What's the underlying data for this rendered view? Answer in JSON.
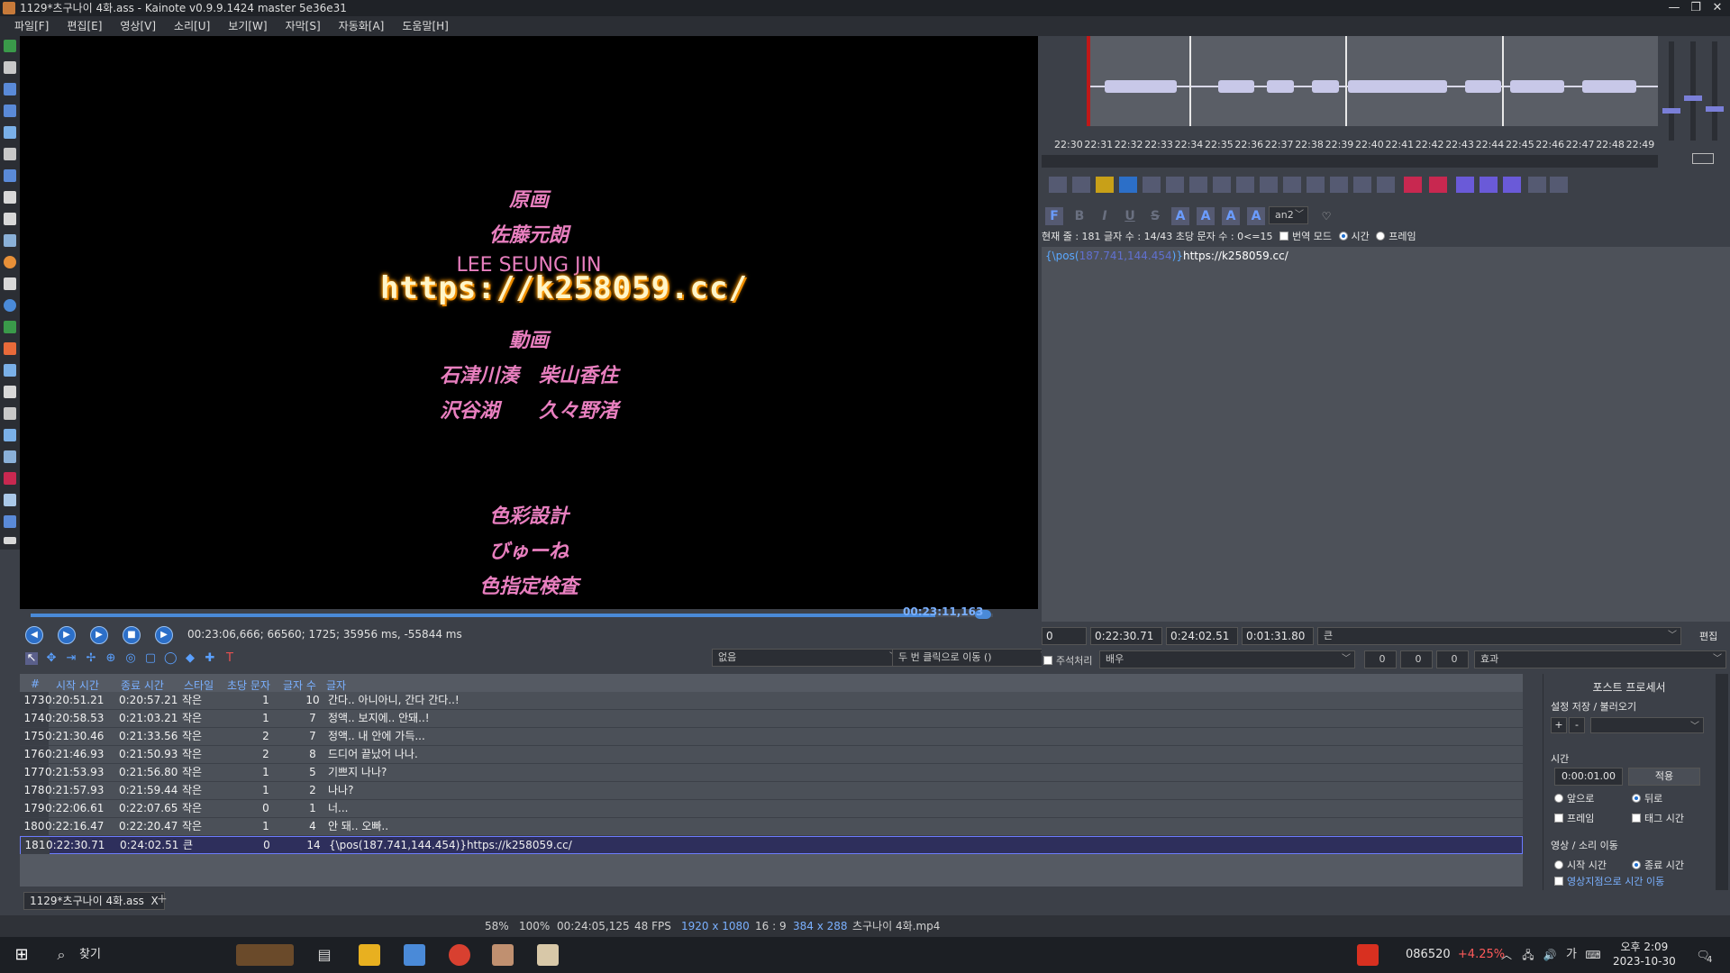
{
  "window": {
    "title": "1129*츠구나이 4화.ass - Kainote v0.9.9.1424  master 5e36e31",
    "minimize": "—",
    "maximize": "❐",
    "close": "✕"
  },
  "menu": [
    "파일[F]",
    "편집[E]",
    "영상[V]",
    "소리[U]",
    "보기[W]",
    "자막[S]",
    "자동화[A]",
    "도움말[H]"
  ],
  "video": {
    "lines": [
      "原画",
      "佐藤元朗",
      "LEE SEUNG JIN",
      "動画",
      "石津川湊　柴山香住",
      "沢谷湖　　久々野渚",
      "色彩設計",
      "びゅーね",
      "色指定検査"
    ],
    "overlay_url": "https://k258059.cc/",
    "seek_time": "00:23:11,163",
    "seek_progress": 0.94,
    "info": "00:23:06,666;  66560;  1725;  35956 ms, -55844 ms"
  },
  "video_toolbar": {
    "combo1": "없음",
    "combo2": "두 번 클릭으로 이동 ()"
  },
  "grid": {
    "headers": [
      "#",
      "시작 시간",
      "종료 시간",
      "스타일",
      "초당 문자",
      "글자 수",
      "글자"
    ],
    "rows": [
      {
        "idx": "173",
        "start": "0:20:51.21",
        "end": "0:20:57.21",
        "style": "작은",
        "cps": "1",
        "chars": "10",
        "text": "간다.. 아니아니, 간다 간다..!"
      },
      {
        "idx": "174",
        "start": "0:20:58.53",
        "end": "0:21:03.21",
        "style": "작은",
        "cps": "1",
        "chars": "7",
        "text": "정액.. 보지에.. 안돼..!"
      },
      {
        "idx": "175",
        "start": "0:21:30.46",
        "end": "0:21:33.56",
        "style": "작은",
        "cps": "2",
        "chars": "7",
        "text": "정액.. 내 안에 가득..."
      },
      {
        "idx": "176",
        "start": "0:21:46.93",
        "end": "0:21:50.93",
        "style": "작은",
        "cps": "2",
        "chars": "8",
        "text": "드디어 끝났어 나나."
      },
      {
        "idx": "177",
        "start": "0:21:53.93",
        "end": "0:21:56.80",
        "style": "작은",
        "cps": "1",
        "chars": "5",
        "text": "기쁘지 나나?"
      },
      {
        "idx": "178",
        "start": "0:21:57.93",
        "end": "0:21:59.44",
        "style": "작은",
        "cps": "1",
        "chars": "2",
        "text": "나나?"
      },
      {
        "idx": "179",
        "start": "0:22:06.61",
        "end": "0:22:07.65",
        "style": "작은",
        "cps": "0",
        "chars": "1",
        "text": "너..."
      },
      {
        "idx": "180",
        "start": "0:22:16.47",
        "end": "0:22:20.47",
        "style": "작은",
        "cps": "1",
        "chars": "4",
        "text": "안 돼.. 오빠.."
      },
      {
        "idx": "181",
        "start": "0:22:30.71",
        "end": "0:24:02.51",
        "style": "큰",
        "cps": "0",
        "chars": "14",
        "text": "{\\pos(187.741,144.454)}https://k258059.cc/"
      }
    ]
  },
  "tabs": {
    "file": "1129*츠구나이 4화.ass",
    "close": "X",
    "add": "+"
  },
  "statusbar": {
    "zoom1": "58%",
    "zoom2": "100%",
    "duration": "00:24:05,125",
    "fps": "48 FPS",
    "res": "1920 x 1080",
    "aspect": "16 : 9",
    "script_res": "384 x 288",
    "video_file": "츠구나이 4화.mp4"
  },
  "audio": {
    "ticks": [
      "22:30",
      "22:31",
      "22:32",
      "22:33",
      "22:34",
      "22:35",
      "22:36",
      "22:37",
      "22:38",
      "22:39",
      "22:40",
      "22:41",
      "22:42",
      "22:43",
      "22:44",
      "22:45",
      "22:46",
      "22:47",
      "22:48",
      "22:49"
    ]
  },
  "editor": {
    "an_combo": "an2",
    "info": "현재 줄 : 181  글자 수 : 14/43  초당 문자 수 : 0<=15",
    "translation_mode": "번역 모드",
    "time_label": "시간",
    "frame_label": "프레임",
    "text_tag_open": "{\\pos(",
    "text_tag_num": "187.741,144.454",
    "text_tag_close": ")}",
    "text_body": "https://k258059.cc/",
    "layer": "0",
    "start": "0:22:30.71",
    "end": "0:24:02.51",
    "duration": "0:01:31.80",
    "style": "큰",
    "edit_btn": "편집",
    "comment_label": "주석처리",
    "actor_placeholder": "배우",
    "margin_l": "0",
    "margin_r": "0",
    "margin_v": "0",
    "effect_placeholder": "효과"
  },
  "postproc": {
    "title": "포스트 프로세서",
    "presets_label": "설정 저장 / 불러오기",
    "plus": "+",
    "minus": "-",
    "time_group": "시간",
    "time_value": "0:00:01.00",
    "apply": "적용",
    "forward": "앞으로",
    "backward": "뒤로",
    "frame": "프레임",
    "tag_time": "태그 시간",
    "move_group": "영상 / 소리 이동",
    "start_time": "시작 시간",
    "end_time": "종료 시간",
    "move_to_video": "영상지점으로 시간 이동"
  },
  "taskbar": {
    "search": "찾기",
    "stock_code": "086520",
    "stock_pct": "+4.25%",
    "lang": "가",
    "time": "오후 2:09",
    "date": "2023-10-30",
    "notif": "4"
  }
}
